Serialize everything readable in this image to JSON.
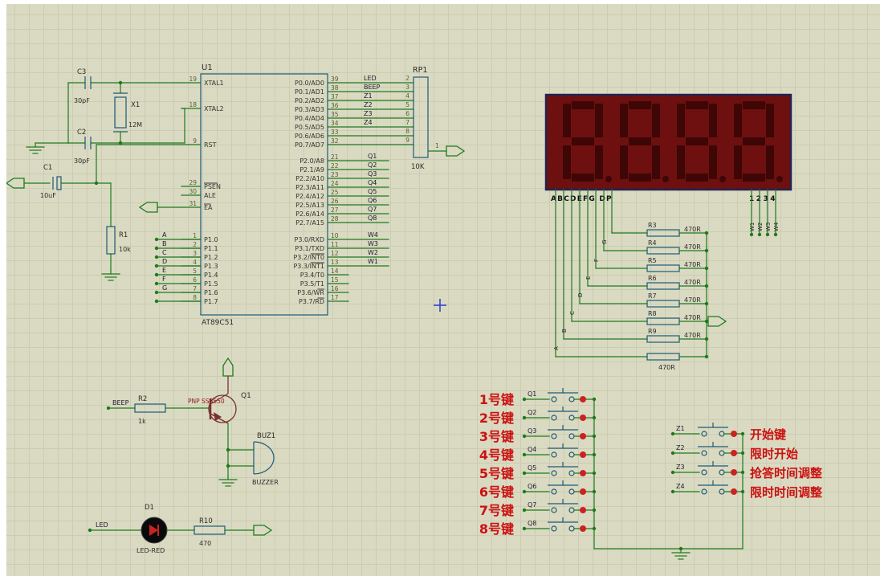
{
  "u1": {
    "ref": "U1",
    "part": "AT89C51",
    "xtal_pins": [
      {
        "num": "19",
        "name": "XTAL1"
      },
      {
        "num": "18",
        "name": "XTAL2"
      }
    ],
    "rst_pin": {
      "num": "9",
      "name": "RST"
    },
    "ctrl_pins": [
      {
        "num": "29",
        "name": "PSEN",
        "bar": 4
      },
      {
        "num": "30",
        "name": "ALE",
        "bar": 0
      },
      {
        "num": "31",
        "name": "EA",
        "bar": 2
      }
    ],
    "p1_pins": [
      {
        "num": "1",
        "name": "P1.0",
        "net": "A"
      },
      {
        "num": "2",
        "name": "P1.1",
        "net": "B"
      },
      {
        "num": "3",
        "name": "P1.2",
        "net": "C"
      },
      {
        "num": "4",
        "name": "P1.3",
        "net": "D"
      },
      {
        "num": "5",
        "name": "P1.4",
        "net": "E"
      },
      {
        "num": "6",
        "name": "P1.5",
        "net": "F"
      },
      {
        "num": "7",
        "name": "P1.6",
        "net": "G"
      },
      {
        "num": "8",
        "name": "P1.7",
        "net": ""
      }
    ],
    "p0_pins": [
      {
        "num": "39",
        "name": "P0.0/AD0",
        "net": "LED"
      },
      {
        "num": "38",
        "name": "P0.1/AD1",
        "net": "BEEP"
      },
      {
        "num": "37",
        "name": "P0.2/AD2",
        "net": "Z1"
      },
      {
        "num": "36",
        "name": "P0.3/AD3",
        "net": "Z2"
      },
      {
        "num": "35",
        "name": "P0.4/AD4",
        "net": "Z3"
      },
      {
        "num": "34",
        "name": "P0.5/AD5",
        "net": "Z4"
      },
      {
        "num": "33",
        "name": "P0.6/AD6",
        "net": ""
      },
      {
        "num": "32",
        "name": "P0.7/AD7",
        "net": ""
      }
    ],
    "p2_pins": [
      {
        "num": "21",
        "name": "P2.0/A8",
        "net": "Q1"
      },
      {
        "num": "22",
        "name": "P2.1/A9",
        "net": "Q2"
      },
      {
        "num": "23",
        "name": "P2.2/A10",
        "net": "Q3"
      },
      {
        "num": "24",
        "name": "P2.3/A11",
        "net": "Q4"
      },
      {
        "num": "25",
        "name": "P2.4/A12",
        "net": "Q5"
      },
      {
        "num": "26",
        "name": "P2.5/A13",
        "net": "Q6"
      },
      {
        "num": "27",
        "name": "P2.6/A14",
        "net": "Q7"
      },
      {
        "num": "28",
        "name": "P2.7/A15",
        "net": "Q8"
      }
    ],
    "p3_pins": [
      {
        "num": "10",
        "name": "P3.0/RXD",
        "net": "W4"
      },
      {
        "num": "11",
        "name": "P3.1/TXD",
        "net": "W3"
      },
      {
        "num": "12",
        "name": "P3.2/INT0",
        "net": "W2",
        "bar": 4
      },
      {
        "num": "13",
        "name": "P3.3/INT1",
        "net": "W1",
        "bar": 4
      },
      {
        "num": "14",
        "name": "P3.4/T0",
        "net": ""
      },
      {
        "num": "15",
        "name": "P3.5/T1",
        "net": ""
      },
      {
        "num": "16",
        "name": "P3.6/WR",
        "net": "",
        "bar": 2
      },
      {
        "num": "17",
        "name": "P3.7/RD",
        "net": "",
        "bar": 2
      }
    ]
  },
  "rp1": {
    "ref": "RP1",
    "value": "10K",
    "pin_nums": [
      "2",
      "3",
      "4",
      "5",
      "6",
      "7",
      "8",
      "9"
    ],
    "pin1": "1"
  },
  "crystal": {
    "ref": "X1",
    "value": "12M"
  },
  "caps": [
    {
      "ref": "C3",
      "value": "30pF"
    },
    {
      "ref": "C2",
      "value": "30pF"
    },
    {
      "ref": "C1",
      "value": "10uF"
    }
  ],
  "r1": {
    "ref": "R1",
    "value": "10k"
  },
  "display": {
    "digits": [
      "8",
      "8",
      "8",
      "8"
    ],
    "segment_label": "ABCDEFG DP",
    "digit_label": "1234"
  },
  "seg_letters": [
    "A",
    "B",
    "C",
    "D",
    "E",
    "F",
    "G"
  ],
  "w_labels": [
    "W1",
    "W2",
    "W3",
    "W4"
  ],
  "resistor_bank": {
    "refs": [
      "R3",
      "R4",
      "R5",
      "R6",
      "R7",
      "R8",
      "R9"
    ],
    "value": "470R",
    "bottom_value": "470R"
  },
  "buzzer_circuit": {
    "beep_label": "BEEP",
    "r2": {
      "ref": "R2",
      "value": "1k"
    },
    "q1": {
      "ref": "Q1",
      "value": "PNP SS8550"
    },
    "buz1": {
      "ref": "BUZ1",
      "value": "BUZZER"
    }
  },
  "led_circuit": {
    "net_label": "LED",
    "d1": {
      "ref": "D1",
      "value": "LED-RED"
    },
    "r10": {
      "ref": "R10",
      "value": "470"
    }
  },
  "number_keys": [
    {
      "net": "Q1",
      "label": "1号键"
    },
    {
      "net": "Q2",
      "label": "2号键"
    },
    {
      "net": "Q3",
      "label": "3号键"
    },
    {
      "net": "Q4",
      "label": "4号键"
    },
    {
      "net": "Q5",
      "label": "5号键"
    },
    {
      "net": "Q6",
      "label": "6号键"
    },
    {
      "net": "Q7",
      "label": "7号键"
    },
    {
      "net": "Q8",
      "label": "8号键"
    }
  ],
  "func_keys": [
    {
      "net": "Z1",
      "label": "开始键"
    },
    {
      "net": "Z2",
      "label": "限时开始"
    },
    {
      "net": "Z3",
      "label": "抢答时间调整"
    },
    {
      "net": "Z4",
      "label": "限时时间调整"
    }
  ],
  "colors": {
    "background": "#dadac2",
    "grid": "#ccccb2",
    "wire": "#1d7a1d",
    "component": "#1d5a78",
    "transistor": "#7a3030",
    "display_face": "#6e1010",
    "display_segment": "#3f0606",
    "display_frame": "#23234f",
    "key_label": "#cc1111",
    "indicator": "#cc2222"
  }
}
